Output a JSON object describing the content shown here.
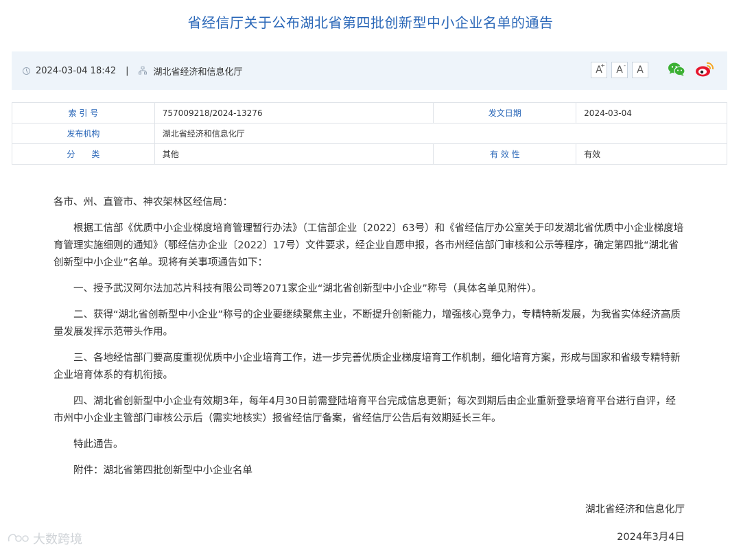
{
  "page": {
    "title": "省经信厅关于公布湖北省第四批创新型中小企业名单的通告"
  },
  "meta": {
    "datetime": "2024-03-04 18:42",
    "separator": "|",
    "source": "湖北省经济和信息化厅",
    "font_buttons": [
      {
        "label": "A",
        "sup": "+"
      },
      {
        "label": "A",
        "sup": "-"
      },
      {
        "label": "A",
        "sup": ""
      }
    ],
    "share_icons": [
      "wechat-icon",
      "weibo-icon"
    ]
  },
  "info": {
    "index_label": "索 引 号",
    "index_value": "757009218/2024-13276",
    "issue_date_label": "发文日期",
    "issue_date_value": "2024-03-04",
    "publisher_label": "发布机构",
    "publisher_value": "湖北省经济和信息化厅",
    "category_label": "分　　类",
    "category_value": "其他",
    "validity_label": "有 效 性",
    "validity_value": "有效"
  },
  "body": {
    "salutation": "各市、州、直管市、神农架林区经信局：",
    "paragraphs": [
      "根据工信部《优质中小企业梯度培育管理暂行办法》（工信部企业〔2022〕63号）和《省经信厅办公室关于印发湖北省优质中小企业梯度培育管理实施细则的通知》（鄂经信办企业〔2022〕17号）文件要求，经企业自愿申报，各市州经信部门审核和公示等程序，确定第四批“湖北省创新型中小企业”名单。现将有关事项通告如下：",
      "一、授予武汉阿尔法加芯片科技有限公司等2071家企业“湖北省创新型中小企业”称号（具体名单见附件）。",
      "二、获得“湖北省创新型中小企业”称号的企业要继续聚焦主业，不断提升创新能力，增强核心竞争力，专精特新发展，为我省实体经济高质量发展发挥示范带头作用。",
      "三、各地经信部门要高度重视优质中小企业培育工作，进一步完善优质企业梯度培育工作机制，细化培育方案，形成与国家和省级专精特新企业培育体系的有机衔接。",
      "四、湖北省创新型中小企业有效期3年，每年4月30日前需登陆培育平台完成信息更新；每次到期后由企业重新登录培育平台进行自评，经市州中小企业主管部门审核公示后（需实地核实）报省经信厅备案，省经信厅公告后有效期延长三年。",
      "特此通告。",
      "附件：湖北省第四批创新型中小企业名单"
    ],
    "signature": "湖北省经济和信息化厅",
    "date": "2024年3月4日"
  },
  "watermark": {
    "text": "大数跨境"
  },
  "colors": {
    "title": "#2a67b8",
    "label": "#2a67b8",
    "meta_bg": "#eef4fa",
    "wechat": "#3cb034",
    "weibo": "#e6162d"
  }
}
